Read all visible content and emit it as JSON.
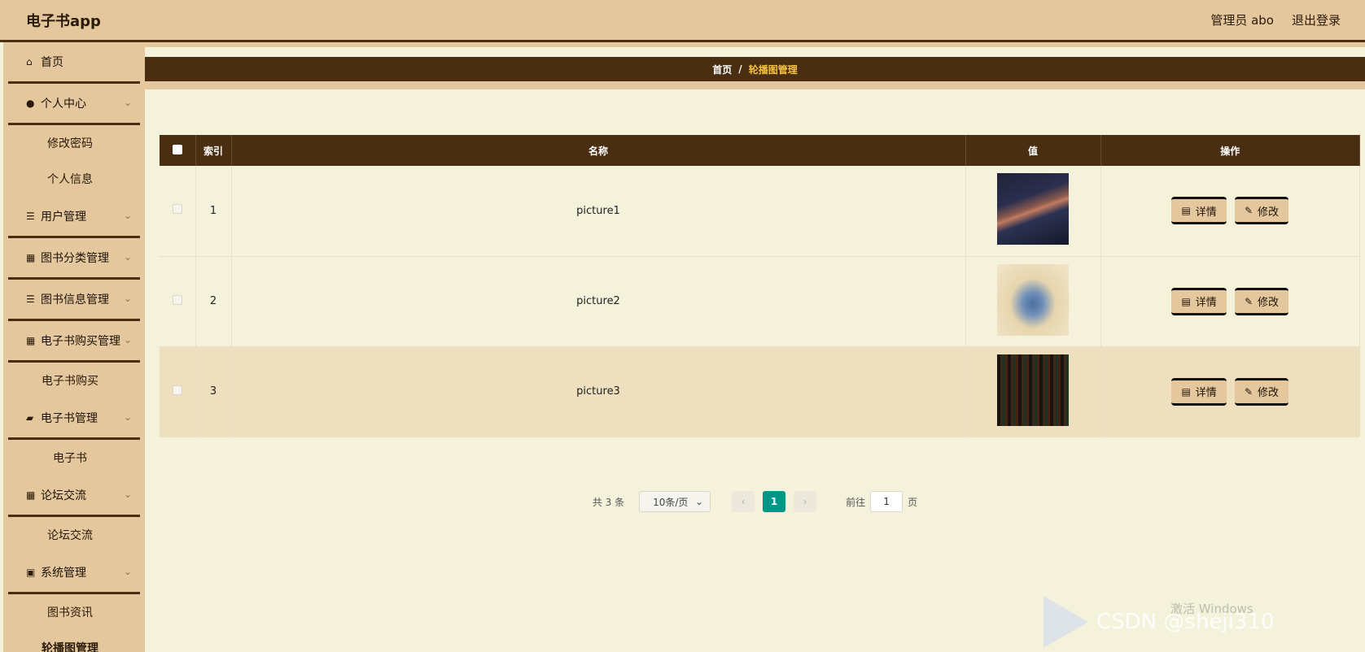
{
  "header": {
    "app_title": "电子书app",
    "admin_label": "管理员 abo",
    "logout_label": "退出登录"
  },
  "sidebar": {
    "home": "首页",
    "personal_center": "个人中心",
    "change_password": "修改密码",
    "personal_info": "个人信息",
    "user_mgmt": "用户管理",
    "book_category_mgmt": "图书分类管理",
    "book_info_mgmt": "图书信息管理",
    "ebook_purchase_mgmt": "电子书购买管理",
    "ebook_purchase": "电子书购买",
    "ebook_mgmt": "电子书管理",
    "ebook": "电子书",
    "forum": "论坛交流",
    "forum_sub": "论坛交流",
    "system_mgmt": "系统管理",
    "book_news": "图书资讯",
    "carousel_mgmt": "轮播图管理"
  },
  "breadcrumb": {
    "home": "首页",
    "separator": "/",
    "current": "轮播图管理"
  },
  "table": {
    "headers": {
      "index": "索引",
      "name": "名称",
      "value": "值",
      "actions": "操作"
    },
    "rows": [
      {
        "index": "1",
        "name": "picture1"
      },
      {
        "index": "2",
        "name": "picture2"
      },
      {
        "index": "3",
        "name": "picture3"
      }
    ],
    "detail_label": "详情",
    "edit_label": "修改"
  },
  "pagination": {
    "total": "共 3 条",
    "page_size": "10条/页",
    "current_page": "1",
    "goto_label": "前往",
    "goto_value": "1",
    "page_suffix": "页"
  },
  "watermark": {
    "text": "CSDN @sheji310",
    "activate": "激活 Windows"
  }
}
